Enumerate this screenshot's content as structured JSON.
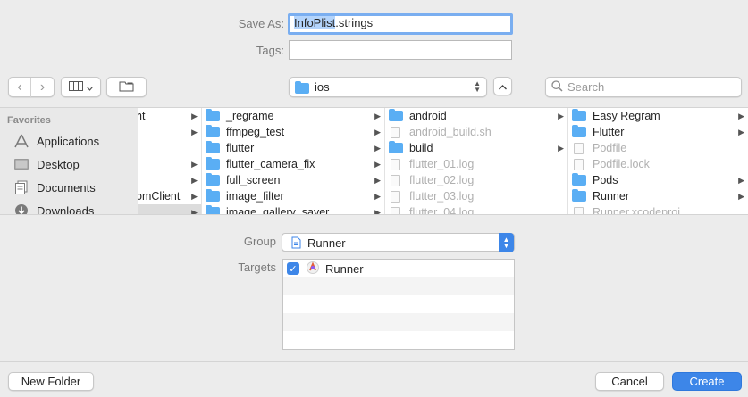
{
  "save_as": {
    "label": "Save As:",
    "value_selected": "InfoPlist",
    "value_rest": ".strings"
  },
  "tags": {
    "label": "Tags:",
    "value": ""
  },
  "toolbar": {
    "back": "‹",
    "forward": "›",
    "location": "ios",
    "search_placeholder": "Search"
  },
  "sidebar": {
    "header": "Favorites",
    "items": [
      {
        "label": "Applications",
        "icon": "applications-icon"
      },
      {
        "label": "Desktop",
        "icon": "desktop-icon"
      },
      {
        "label": "Documents",
        "icon": "documents-icon"
      },
      {
        "label": "Downloads",
        "icon": "downloads-icon"
      }
    ]
  },
  "columns": {
    "col1": [
      {
        "label": "nt",
        "chevron": true
      },
      {
        "label": "",
        "chevron": true
      },
      {
        "label": "",
        "chevron": false
      },
      {
        "label": "",
        "chevron": true
      },
      {
        "label": "",
        "chevron": true
      },
      {
        "label": "omClient",
        "chevron": true
      },
      {
        "label": "",
        "chevron": true
      }
    ],
    "col2": [
      {
        "label": "_regrame"
      },
      {
        "label": "ffmpeg_test"
      },
      {
        "label": "flutter"
      },
      {
        "label": "flutter_camera_fix"
      },
      {
        "label": "full_screen"
      },
      {
        "label": "image_filter"
      },
      {
        "label": "image_gallery_saver"
      }
    ],
    "col3": [
      {
        "label": "android"
      },
      {
        "label": "android_build.sh"
      },
      {
        "label": "build"
      },
      {
        "label": "flutter_01.log"
      },
      {
        "label": "flutter_02.log"
      },
      {
        "label": "flutter_03.log"
      },
      {
        "label": "flutter_04.log"
      }
    ],
    "col4": [
      {
        "label": "Easy Regram"
      },
      {
        "label": "Flutter"
      },
      {
        "label": "Podfile"
      },
      {
        "label": "Podfile.lock"
      },
      {
        "label": "Pods"
      },
      {
        "label": "Runner"
      },
      {
        "label": "Runner.xcodeproj"
      }
    ]
  },
  "group": {
    "label": "Group",
    "value": "Runner"
  },
  "targets": {
    "label": "Targets",
    "items": [
      {
        "label": "Runner",
        "checked": true
      }
    ]
  },
  "buttons": {
    "new_folder": "New Folder",
    "cancel": "Cancel",
    "create": "Create"
  },
  "colors": {
    "accent": "#3d86e8",
    "folder": "#5aaef4",
    "selection": "#b3d4fc"
  }
}
